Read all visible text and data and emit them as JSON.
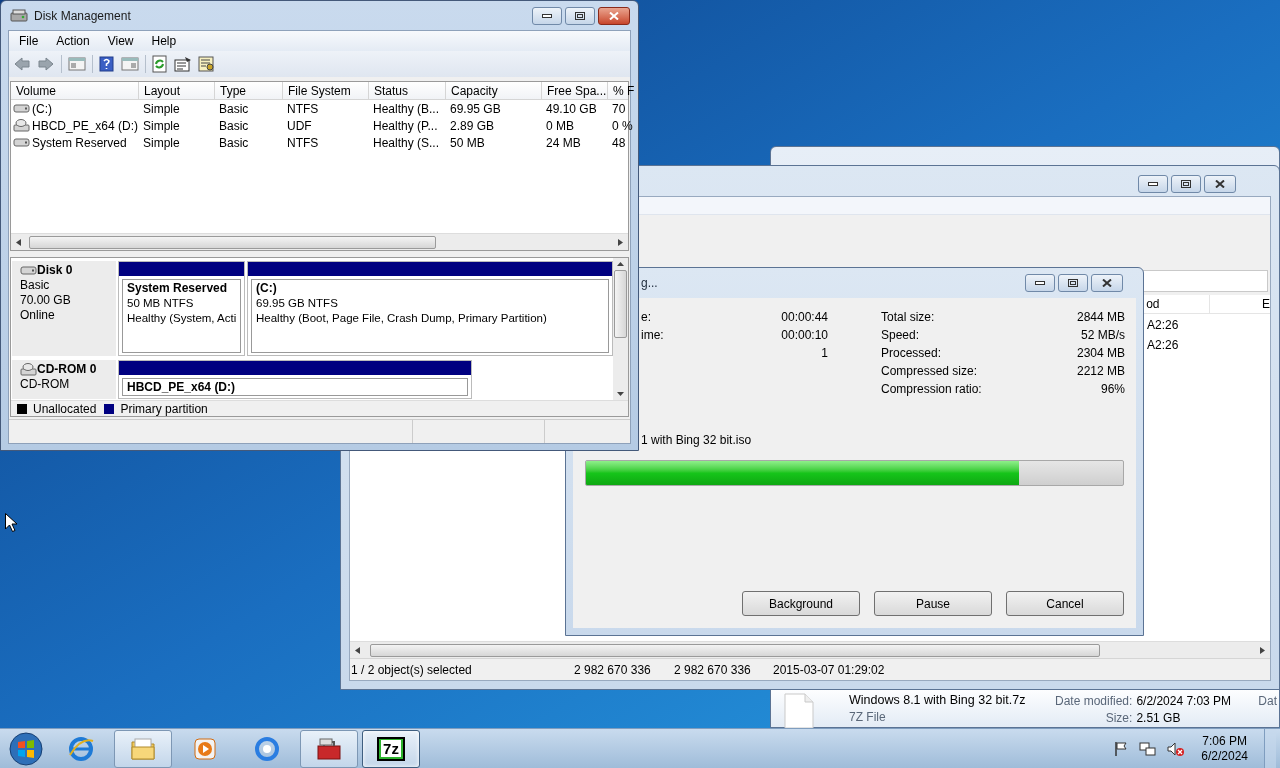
{
  "disk_management": {
    "title": "Disk Management",
    "menu": [
      "File",
      "Action",
      "View",
      "Help"
    ],
    "columns": [
      "Volume",
      "Layout",
      "Type",
      "File System",
      "Status",
      "Capacity",
      "Free Spa...",
      "% F"
    ],
    "rows": [
      {
        "kind": "disk",
        "cells": [
          "(C:)",
          "Simple",
          "Basic",
          "NTFS",
          "Healthy (B...",
          "69.95 GB",
          "49.10 GB",
          "70"
        ]
      },
      {
        "kind": "cdrom",
        "cells": [
          "HBCD_PE_x64 (D:)",
          "Simple",
          "Basic",
          "UDF",
          "Healthy (P...",
          "2.89 GB",
          "0 MB",
          "0 %"
        ]
      },
      {
        "kind": "disk",
        "cells": [
          "System Reserved",
          "Simple",
          "Basic",
          "NTFS",
          "Healthy (S...",
          "50 MB",
          "24 MB",
          "48"
        ]
      }
    ],
    "disks": [
      {
        "kind": "disk",
        "name": "Disk 0",
        "lines": [
          "Basic",
          "70.00 GB",
          "Online"
        ],
        "partitions": [
          {
            "name": "System Reserved",
            "lines": [
              "50 MB NTFS",
              "Healthy (System, Acti"
            ]
          },
          {
            "name": "(C:)",
            "lines": [
              "69.95 GB NTFS",
              "Healthy (Boot, Page File, Crash Dump, Primary Partition)"
            ]
          }
        ]
      },
      {
        "kind": "cdrom",
        "name": "CD-ROM 0",
        "lines": [
          "CD-ROM"
        ],
        "partitions": [
          {
            "name": "HBCD_PE_x64 (D:)"
          }
        ]
      }
    ],
    "legend": [
      {
        "label": "Unallocated",
        "color": "#000000"
      },
      {
        "label": "Primary partition",
        "color": "#000080"
      }
    ]
  },
  "file_manager": {
    "columns": [
      "od",
      "E"
    ],
    "rows": [
      "A2:26",
      "A2:26"
    ],
    "status": [
      "1 / 2 object(s) selected",
      "2 982 670 336",
      "2 982 670 336",
      "2015-03-07 01:29:02"
    ]
  },
  "progress_dialog": {
    "title": "g...",
    "left": [
      {
        "label": "e:",
        "value": "00:00:44"
      },
      {
        "label": "ime:",
        "value": "00:00:10"
      },
      {
        "value": "1"
      }
    ],
    "right": [
      {
        "label": "Total size:",
        "value": "2844 MB"
      },
      {
        "label": "Speed:",
        "value": "52 MB/s"
      },
      {
        "label": "Processed:",
        "value": "2304 MB"
      },
      {
        "label": "Compressed size:",
        "value": "2212 MB"
      },
      {
        "label": "Compression ratio:",
        "value": "96%"
      }
    ],
    "file": "1 with Bing 32 bit.iso",
    "level": 0.807,
    "buttons": [
      "Background",
      "Pause",
      "Cancel"
    ]
  },
  "details_pane": {
    "name": "Windows 8.1 with Bing 32 bit.7z",
    "type": "7Z File",
    "fields": [
      {
        "label": "Date modified:",
        "value": "6/2/2024 7:03 PM"
      },
      {
        "label": "Size:",
        "value": "2.51 GB"
      }
    ],
    "extra": "Dat"
  },
  "taskbar": {
    "apps": [
      {
        "kind": "ie",
        "running": false,
        "selected": false
      },
      {
        "kind": "explorer",
        "running": true,
        "selected": false
      },
      {
        "kind": "media",
        "running": false,
        "selected": false
      },
      {
        "kind": "chrome",
        "running": false,
        "selected": false
      },
      {
        "kind": "toolbox",
        "running": true,
        "selected": false
      },
      {
        "kind": "sevenzip",
        "label": "7z",
        "running": true,
        "selected": true
      }
    ],
    "time": "7:06 PM",
    "date": "6/2/2024"
  }
}
